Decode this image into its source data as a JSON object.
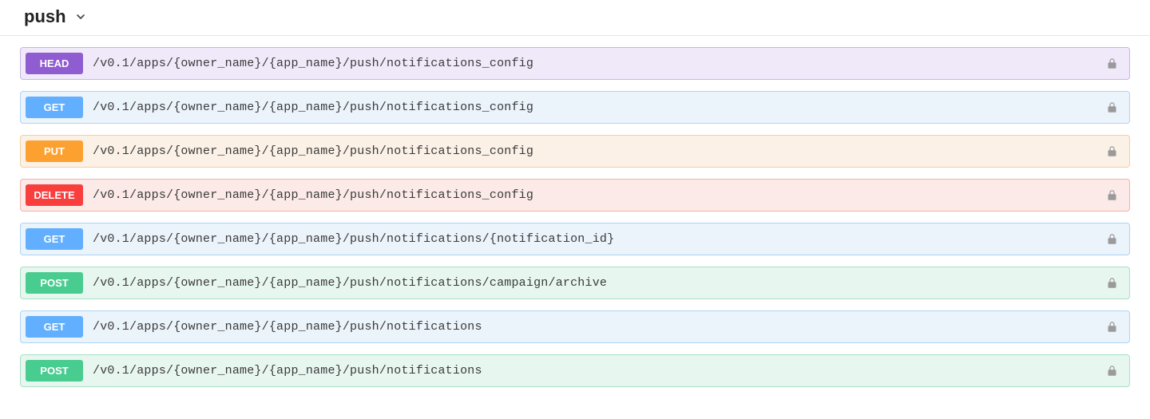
{
  "section": {
    "title": "push"
  },
  "operations": [
    {
      "method": "HEAD",
      "cls": "m-head",
      "path": "/v0.1/apps/{owner_name}/{app_name}/push/notifications_config",
      "locked": true
    },
    {
      "method": "GET",
      "cls": "m-get",
      "path": "/v0.1/apps/{owner_name}/{app_name}/push/notifications_config",
      "locked": true
    },
    {
      "method": "PUT",
      "cls": "m-put",
      "path": "/v0.1/apps/{owner_name}/{app_name}/push/notifications_config",
      "locked": true
    },
    {
      "method": "DELETE",
      "cls": "m-delete",
      "path": "/v0.1/apps/{owner_name}/{app_name}/push/notifications_config",
      "locked": true
    },
    {
      "method": "GET",
      "cls": "m-get",
      "path": "/v0.1/apps/{owner_name}/{app_name}/push/notifications/{notification_id}",
      "locked": true
    },
    {
      "method": "POST",
      "cls": "m-post",
      "path": "/v0.1/apps/{owner_name}/{app_name}/push/notifications/campaign/archive",
      "locked": true
    },
    {
      "method": "GET",
      "cls": "m-get",
      "path": "/v0.1/apps/{owner_name}/{app_name}/push/notifications",
      "locked": true
    },
    {
      "method": "POST",
      "cls": "m-post",
      "path": "/v0.1/apps/{owner_name}/{app_name}/push/notifications",
      "locked": true
    }
  ]
}
